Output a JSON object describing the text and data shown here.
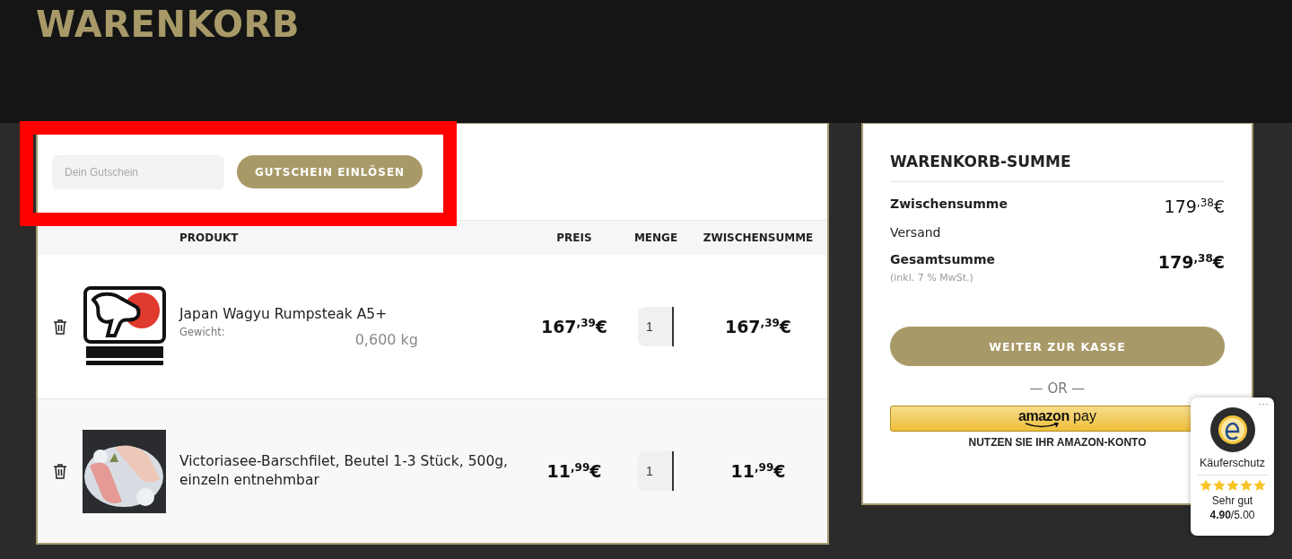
{
  "page_title": "WARENKORB",
  "coupon": {
    "placeholder": "Dein Gutschein",
    "button": "GUTSCHEIN EINLÖSEN"
  },
  "table": {
    "columns": [
      "PRODUKT",
      "PREIS",
      "MENGE",
      "ZWISCHENSUMME"
    ],
    "rows": [
      {
        "name": "Japan Wagyu Rumpsteak A5+",
        "attribute_label": "Gewicht:",
        "attribute_value": "0,600 kg",
        "price": "167$^{,39}$€",
        "quantity": "1",
        "subtotal": "167$^{,39}$€",
        "image": {
          "kind": "logo"
        }
      },
      {
        "name": "Victoriasee-Barschfilet, Beutel 1-3 Stück, 500g, einzeln entnehmbar",
        "price": "11$^{,99}$€",
        "quantity": "1",
        "subtotal": "11$^{,99}$€"
      }
    ]
  },
  "totals": {
    "title": "WARENKORB-SUMME",
    "lines": [
      {
        "kind": "subtotal",
        "label": "Zwischensumme",
        "value": "179$^{,38}$€"
      },
      {
        "kind": "shipping",
        "label": "Versand"
      },
      {
        "kind": "total",
        "label": "Gesamtsumme",
        "note": "(inkl. 7 % MwSt.)",
        "value": "179$^{,38}$€"
      }
    ],
    "checkout_button": "WEITER ZUR KASSE",
    "separator": "— OR —",
    "amazon_pay": {
      "logo_bold": "amazon",
      "logo_light": "pay",
      "caption": "NUTZEN SIE IHR AMAZON-KONTO"
    }
  },
  "trust_badge": {
    "menu": "···",
    "title": "Käuferschutz",
    "stars": 5,
    "rating_text": "Sehr gut",
    "score": "**4.90**/5.00"
  }
}
